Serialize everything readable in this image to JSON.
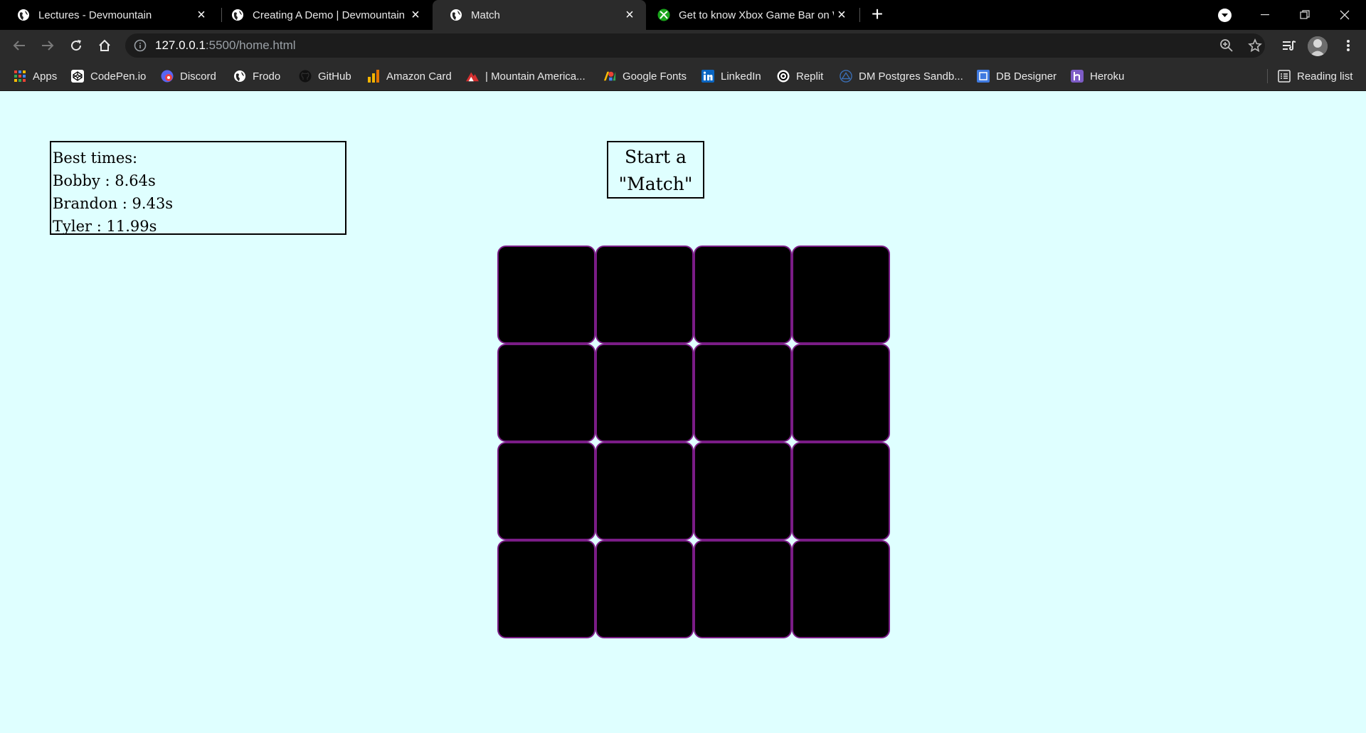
{
  "tabs": [
    {
      "title": "Lectures - Devmountain",
      "favicon": "globe-icon",
      "active": false
    },
    {
      "title": "Creating A Demo | Devmountain",
      "favicon": "globe-icon",
      "active": false
    },
    {
      "title": "Match",
      "favicon": "globe-icon",
      "active": true
    },
    {
      "title": "Get to know Xbox Game Bar on W",
      "favicon": "xbox-icon",
      "active": false
    }
  ],
  "new_tab_label": "+",
  "address": {
    "host": "127.0.0.1",
    "path": ":5500/home.html"
  },
  "bookmarks": [
    {
      "label": "Apps",
      "icon": "apps-grid-icon"
    },
    {
      "label": "CodePen.io",
      "icon": "codepen-icon"
    },
    {
      "label": "Discord",
      "icon": "discord-icon"
    },
    {
      "label": "Frodo",
      "icon": "globe-icon"
    },
    {
      "label": "GitHub",
      "icon": "github-icon"
    },
    {
      "label": "Amazon Card",
      "icon": "bar-chart-icon"
    },
    {
      "label": "| Mountain America...",
      "icon": "mountain-icon"
    },
    {
      "label": "Google Fonts",
      "icon": "google-fonts-icon"
    },
    {
      "label": "LinkedIn",
      "icon": "linkedin-icon"
    },
    {
      "label": "Replit",
      "icon": "replit-icon"
    },
    {
      "label": "DM Postgres Sandb...",
      "icon": "postgres-icon"
    },
    {
      "label": "DB Designer",
      "icon": "db-designer-icon"
    },
    {
      "label": "Heroku",
      "icon": "heroku-icon"
    }
  ],
  "reading_list": "Reading list",
  "best_times": {
    "heading": "Best times:",
    "entries": [
      "Bobby : 8.64s",
      "Brandon : 9.43s",
      "Tyler : 11.99s"
    ]
  },
  "start_button": {
    "line1": "Start a",
    "line2": "\"Match\""
  },
  "board": {
    "rows": 4,
    "cols": 4,
    "card_color": "#000000",
    "card_border_color": "#7a1c86"
  },
  "colors": {
    "page_bg": "#dfffff",
    "chrome_dark": "#2b2b2b",
    "tabstrip": "#000000"
  }
}
